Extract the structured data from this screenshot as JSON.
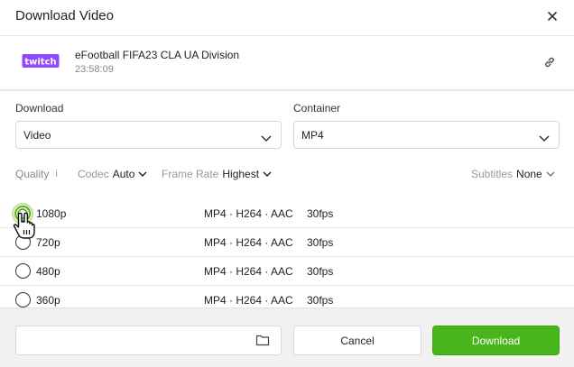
{
  "dialog": {
    "title": "Download Video"
  },
  "media": {
    "title": "eFootball FIFA23 CLA UA Division",
    "duration": "23:58:09",
    "logo_text": "twitch",
    "brand_color": "#9147ff"
  },
  "download": {
    "label": "Download",
    "value": "Video"
  },
  "container": {
    "label": "Container",
    "value": "MP4"
  },
  "options": {
    "quality_label": "Quality",
    "info_glyph": "i",
    "codec_label": "Codec",
    "codec_value": "Auto",
    "frame_rate_label": "Frame Rate",
    "frame_rate_value": "Highest",
    "subtitles_label": "Subtitles",
    "subtitles_value": "None"
  },
  "rows": [
    {
      "resolution": "1080p",
      "format": "MP4 · H264 · AAC",
      "fps": "30fps"
    },
    {
      "resolution": "720p",
      "format": "MP4 · H264 · AAC",
      "fps": "30fps"
    },
    {
      "resolution": "480p",
      "format": "MP4 · H264 · AAC",
      "fps": "30fps"
    },
    {
      "resolution": "360p",
      "format": "MP4 · H264 · AAC",
      "fps": "30fps"
    }
  ],
  "footer": {
    "path_value": "",
    "cancel_label": "Cancel",
    "download_label": "Download",
    "accent": "#48b51c"
  }
}
